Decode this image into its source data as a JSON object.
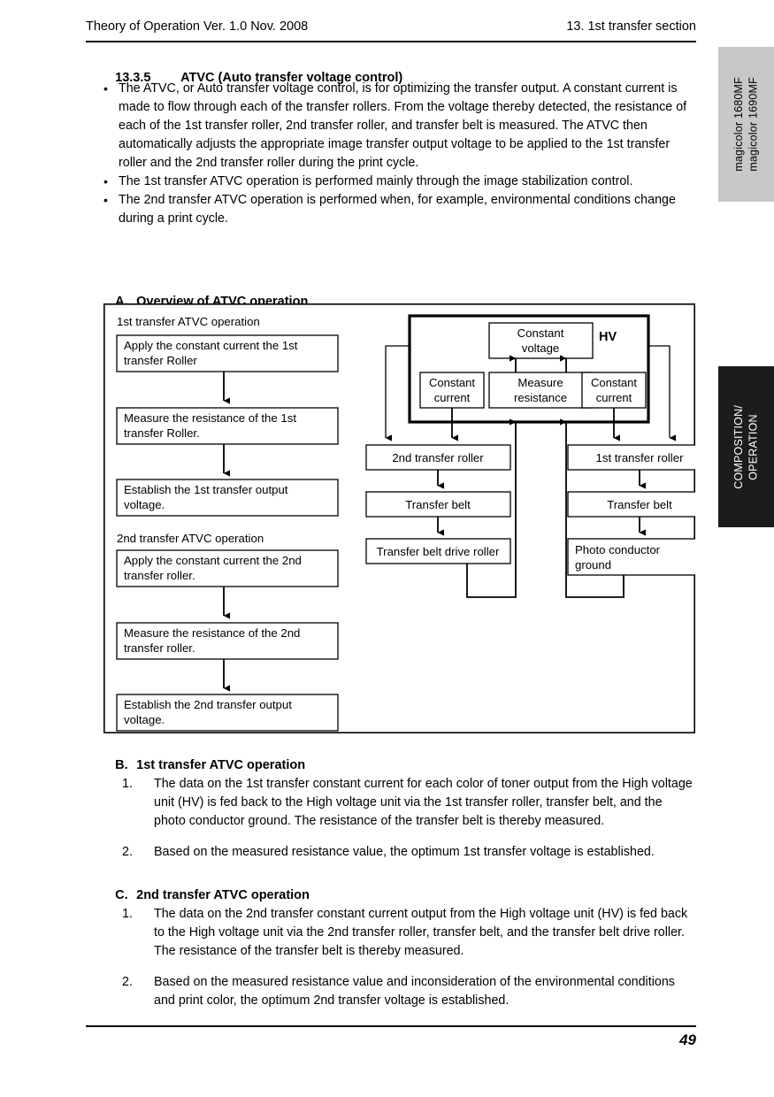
{
  "header": {
    "left": "Theory of Operation Ver. 1.0 Nov. 2008",
    "right": "13. 1st transfer section"
  },
  "footer": {
    "page_number": "49"
  },
  "side_tabs": {
    "product": "magicolor 1680MF\nmagicolor 1690MF",
    "section": "COMPOSITION/\nOPERATION"
  },
  "section": {
    "number": "13.3.5",
    "title": "ATVC (Auto transfer voltage control)"
  },
  "intro_bullets": [
    "The ATVC, or Auto transfer voltage control, is for optimizing the transfer output. A constant current is made to flow through each of the transfer rollers. From the voltage thereby detected, the resistance of each of the 1st transfer roller, 2nd transfer roller, and transfer belt is measured. The ATVC then automatically adjusts the appropriate image transfer output voltage to be applied to the 1st transfer roller and the 2nd transfer roller during the print cycle.",
    "The 1st transfer ATVC operation is performed mainly through the image stabilization control.",
    "The 2nd transfer ATVC operation is performed when, for example, environmental conditions change during a print cycle."
  ],
  "subsections": {
    "a": {
      "label": "A.",
      "title": "Overview of ATVC operation"
    },
    "b": {
      "label": "B.",
      "title": "1st transfer ATVC operation",
      "items": [
        {
          "n": "1.",
          "text": "The data on the 1st transfer constant current for each color of toner output from the High voltage unit (HV) is fed back to the High voltage unit via the 1st transfer roller, transfer belt, and the photo conductor ground. The resistance of the transfer belt is thereby measured."
        },
        {
          "n": "2.",
          "text": "Based on the measured resistance value, the optimum 1st transfer voltage is established."
        }
      ]
    },
    "c": {
      "label": "C.",
      "title": "2nd transfer ATVC operation",
      "items": [
        {
          "n": "1.",
          "text": "The data on the 2nd transfer constant current output from the High voltage unit (HV) is fed back to the High voltage unit via the 2nd transfer roller, transfer belt, and the transfer belt drive roller. The resistance of the transfer belt is thereby measured."
        },
        {
          "n": "2.",
          "text": "Based on the measured resistance value and inconsideration of the environmental conditions and print color, the optimum 2nd transfer voltage is established."
        }
      ]
    }
  },
  "diagram": {
    "flow_first": {
      "caption": "1st transfer ATVC operation",
      "steps": [
        "Apply the constant current the 1st transfer Roller",
        "Measure the resistance of the 1st transfer Roller.",
        "Establish the 1st transfer output voltage."
      ]
    },
    "flow_second": {
      "caption": "2nd transfer ATVC operation",
      "steps": [
        "Apply the constant current the 2nd transfer roller.",
        "Measure the resistance of the 2nd transfer roller.",
        "Establish the 2nd transfer output voltage."
      ]
    },
    "hv": {
      "title": "HV",
      "constant_voltage": "Constant voltage",
      "constant_current_left": "Constant current",
      "measure_resistance": "Measure resistance",
      "constant_current_right": "Constant current"
    },
    "chain_left": [
      "2nd transfer roller",
      "Transfer belt",
      "Transfer belt drive roller"
    ],
    "chain_right": [
      "1st transfer roller",
      "Transfer belt",
      "Photo conductor ground"
    ]
  }
}
